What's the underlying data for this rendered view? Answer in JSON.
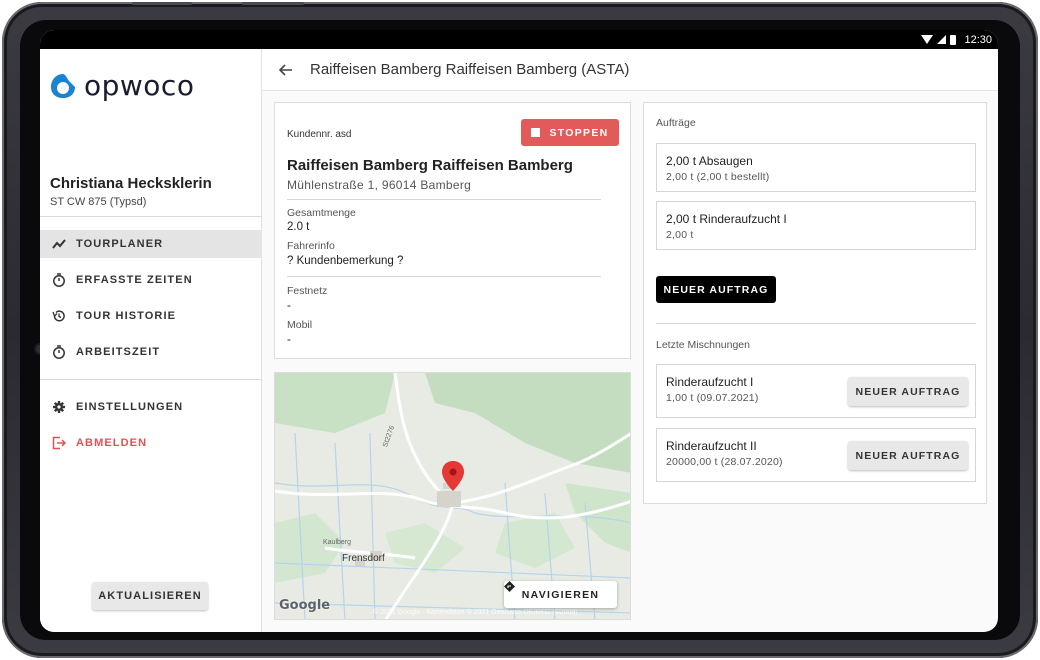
{
  "status_bar": {
    "time": "12:30"
  },
  "brand": {
    "logo_text": "opwoco",
    "accent": "#1a84d0",
    "danger": "#e35a5a"
  },
  "user": {
    "name": "Christiana Hecksklerin",
    "vehicle": "ST CW 875 (Typsd)"
  },
  "nav": {
    "items": [
      {
        "label": "TOURPLANER",
        "icon": "trend-icon",
        "active": true
      },
      {
        "label": "ERFASSTE ZEITEN",
        "icon": "timer-icon"
      },
      {
        "label": "TOUR HISTORIE",
        "icon": "history-icon"
      },
      {
        "label": "ARBEITSZEIT",
        "icon": "timer-icon"
      }
    ],
    "settings": "EINSTELLUNGEN",
    "logout": "ABMELDEN"
  },
  "sidebar": {
    "refresh_label": "AKTUALISIEREN"
  },
  "header": {
    "title": "Raiffeisen Bamberg Raiffeisen Bamberg (ASTA)"
  },
  "customer": {
    "number_label": "Kundennr. asd",
    "stop_label": "STOPPEN",
    "name": "Raiffeisen Bamberg Raiffeisen Bamberg",
    "address": "Mühlenstraße 1, 96014 Bamberg",
    "total_label": "Gesamtmenge",
    "total_value": "2.0 t",
    "driver_info_label": "Fahrerinfo",
    "driver_info_value": "? Kundenbemerkung ?",
    "landline_label": "Festnetz",
    "landline_value": "-",
    "mobile_label": "Mobil",
    "mobile_value": "-"
  },
  "map": {
    "town": "Frensdorf",
    "road_label_1": "St2276",
    "road_label_2": "Kaulberg",
    "navigate_label": "NAVIGIEREN",
    "google": "Google",
    "copyright": "© 2021 Google · Kartendaten © 2021 GeoBasis-DE/BKG (©2009)"
  },
  "orders": {
    "label": "Aufträge",
    "items": [
      {
        "title": "2,00 t Absaugen",
        "sub": "2,00 t (2,00 t bestellt)"
      },
      {
        "title": "2,00 t Rinderaufzucht I",
        "sub": "2,00 t"
      }
    ],
    "new_order_label": "NEUER AUFTRAG"
  },
  "mixes": {
    "label": "Letzte Mischnungen",
    "items": [
      {
        "title": "Rinderaufzucht I",
        "sub": "1,00 t (09.07.2021)",
        "button": "NEUER AUFTRAG"
      },
      {
        "title": "Rinderaufzucht II",
        "sub": "20000,00 t (28.07.2020)",
        "button": "NEUER AUFTRAG"
      }
    ]
  }
}
